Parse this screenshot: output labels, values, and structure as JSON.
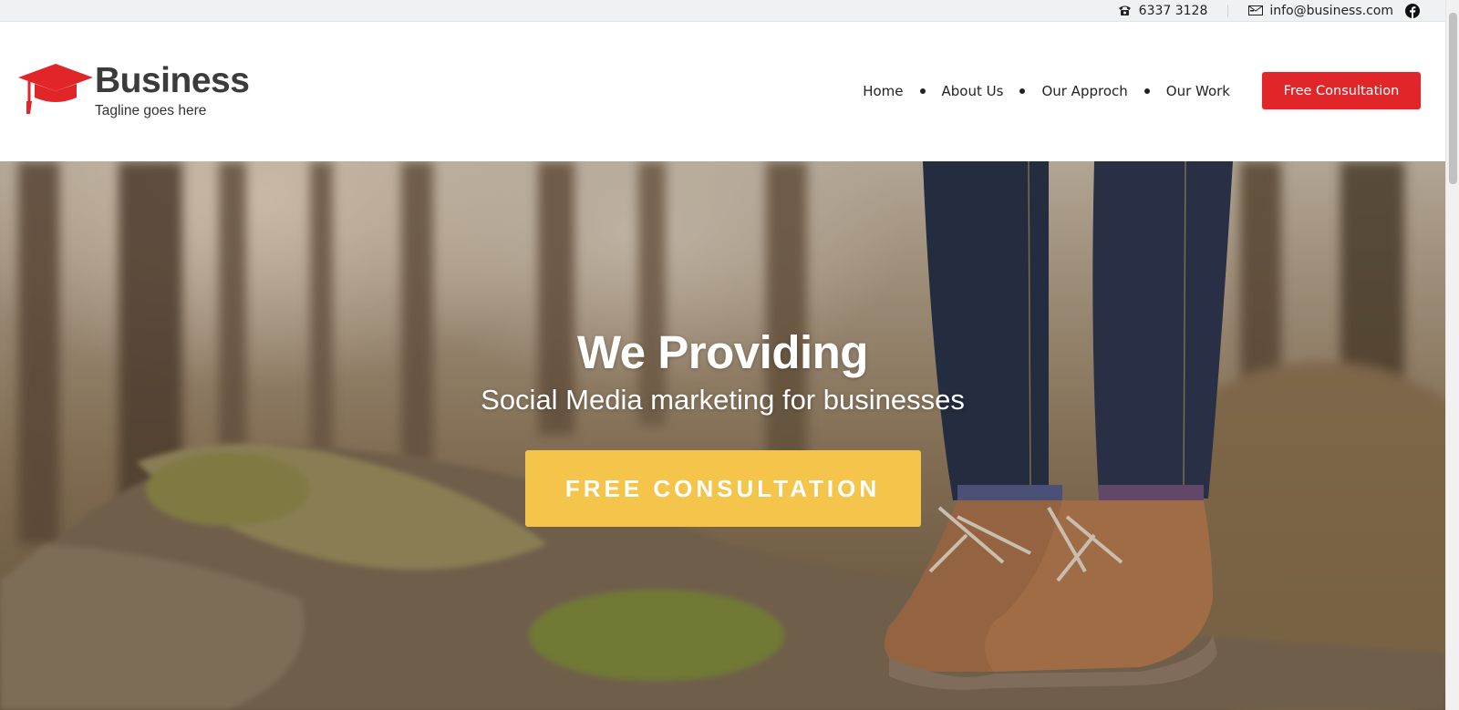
{
  "topbar": {
    "phone_icon": "phone-icon",
    "phone": "6337 3128",
    "email_icon": "envelope-icon",
    "email": "info@business.com",
    "social_icon": "facebook-icon"
  },
  "brand": {
    "name": "Business",
    "tagline": "Tagline goes here",
    "logo_icon": "graduation-cap-icon",
    "logo_color": "#e1262a"
  },
  "nav": {
    "items": [
      {
        "label": "Home"
      },
      {
        "label": "About Us"
      },
      {
        "label": "Our Approch"
      },
      {
        "label": "Our Work"
      }
    ],
    "cta_label": "Free Consultation",
    "cta_color": "#e1262a"
  },
  "hero": {
    "title": "We Providing",
    "subtitle": "Social Media marketing for businesses",
    "button_label": "FREE CONSULTATION",
    "button_color": "#f4c54a"
  }
}
